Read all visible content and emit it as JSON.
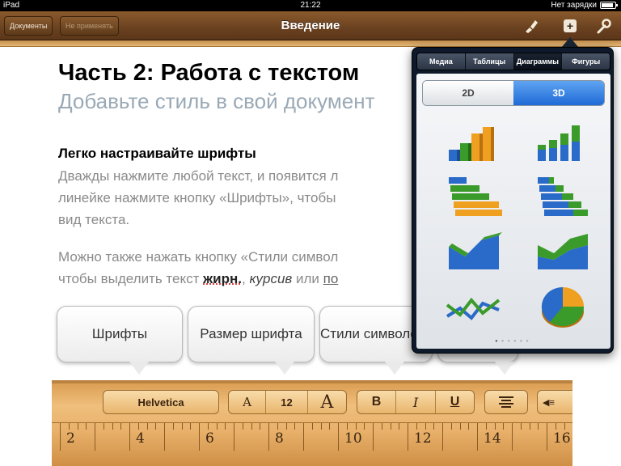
{
  "status": {
    "device": "iPad",
    "time": "21:22",
    "battery": "Нет зарядки",
    "battery_level": 0.9
  },
  "nav": {
    "documents_label": "Документы",
    "undo_label": "Не применять",
    "title": "Введение",
    "icons": [
      "brush-icon",
      "plus-icon",
      "wrench-icon"
    ]
  },
  "doc": {
    "title": "Часть 2: Работа с текстом",
    "subtitle": "Добавьте стиль в свой документ",
    "heading": "Легко настраивайте шрифты",
    "p1_l1": "Дважды нажмите любой текст, и появится л",
    "p1_l2": "линейке нажмите кнопку «Шрифты», чтобы",
    "p1_l3": "вид текста.",
    "p2_l1": "Можно также нажать кнопку «Стили символ",
    "p2_l2_pre": "чтобы выделить текст ",
    "p2_bold": "жирн.",
    "p2_sep": ", ",
    "p2_italic": "курсив",
    "p2_mid": " или ",
    "p2_under": "по"
  },
  "callouts": [
    "Шрифты",
    "Размер шрифта",
    "Стили символов",
    ""
  ],
  "toolbar": {
    "font_name": "Helvetica",
    "font_smaller": "A",
    "font_size": "12",
    "font_larger": "A",
    "bold": "B",
    "italic": "I",
    "underline": "U",
    "ruler_numbers": [
      "2",
      "4",
      "6",
      "8",
      "10",
      "12",
      "14",
      "16"
    ]
  },
  "popover": {
    "tabs": [
      "Медиа",
      "Таблицы",
      "Диаграммы",
      "Фигуры"
    ],
    "active_tab": "Диаграммы",
    "segments": [
      "2D",
      "3D"
    ],
    "active_segment": "3D",
    "chart_styles": [
      "3d-column-chart",
      "3d-stacked-column-chart",
      "3d-bar-chart",
      "3d-stacked-bar-chart",
      "3d-area-chart",
      "3d-stacked-area-chart",
      "3d-line-chart",
      "3d-pie-chart"
    ],
    "page_count": 6,
    "current_page": 1
  },
  "colors": {
    "wood_dark": "#6a4120",
    "active_blue": "#1f6ad6",
    "green": "#3a9a2a",
    "orange": "#f0a020",
    "blue": "#2a6ac8"
  }
}
